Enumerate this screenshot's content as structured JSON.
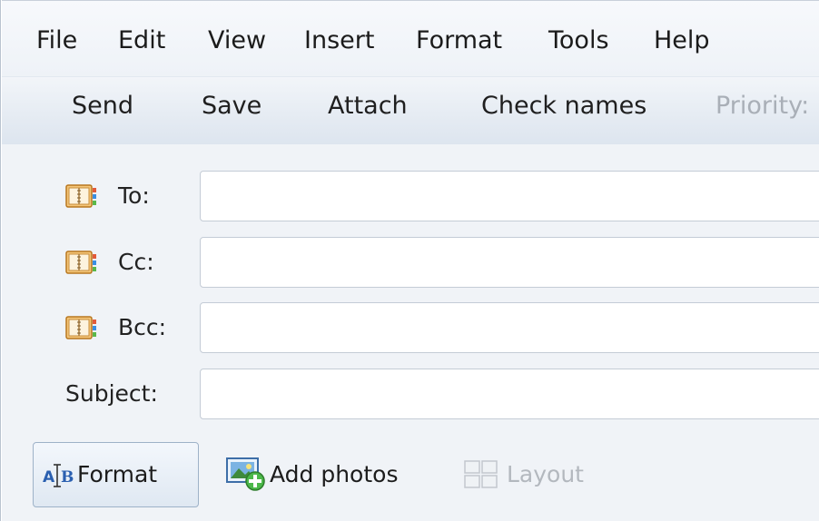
{
  "menu": {
    "items": [
      {
        "label": "File"
      },
      {
        "label": "Edit"
      },
      {
        "label": "View"
      },
      {
        "label": "Insert"
      },
      {
        "label": "Format"
      },
      {
        "label": "Tools"
      },
      {
        "label": "Help"
      }
    ]
  },
  "toolbar": {
    "send": "Send",
    "save": "Save",
    "attach": "Attach",
    "check_names": "Check names",
    "priority": "Priority:"
  },
  "fields": {
    "to_label": "To:",
    "cc_label": "Cc:",
    "bcc_label": "Bcc:",
    "subject_label": "Subject:",
    "to_value": "",
    "cc_value": "",
    "bcc_value": "",
    "subject_value": ""
  },
  "format_bar": {
    "format_label": "Format",
    "add_photos_label": "Add photos",
    "layout_label": "Layout"
  },
  "colors": {
    "toolbar_bg": "#e6ecf3",
    "field_area_bg": "#f0f3f7",
    "disabled_text": "#a9afb7",
    "book_icon": "#e8a23a"
  },
  "icons": [
    "address-book-icon",
    "format-text-icon",
    "add-photos-icon",
    "layout-icon"
  ]
}
